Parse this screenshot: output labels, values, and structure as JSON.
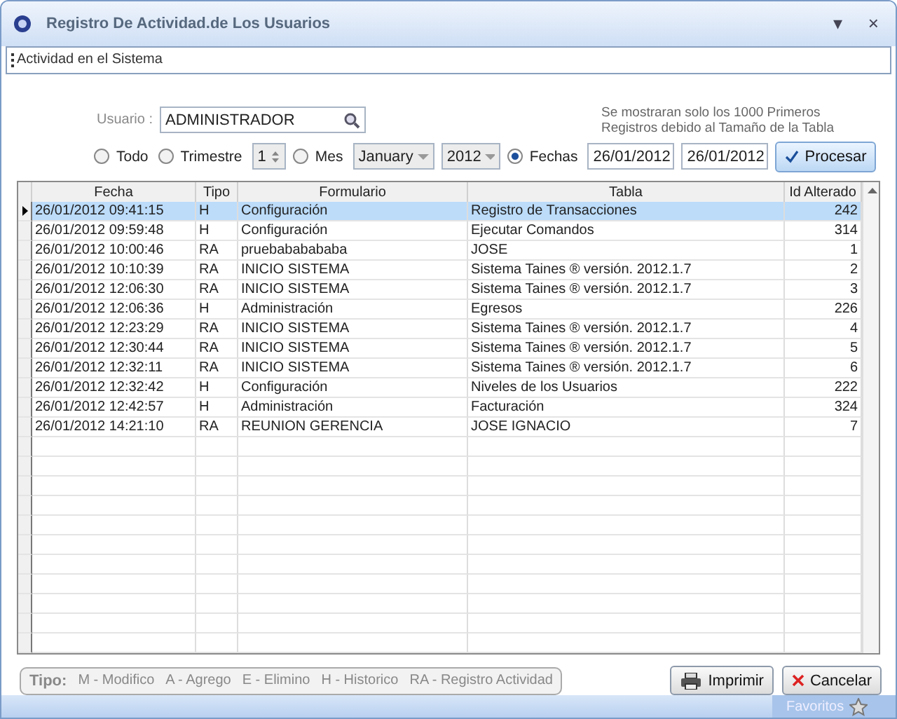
{
  "window": {
    "title": "Registro De Actividad.de Los Usuarios",
    "menu_glyph": "▾",
    "close_glyph": "×"
  },
  "toolbar": {
    "label": "Actividad en el Sistema"
  },
  "filters": {
    "user_label": "Usuario :",
    "user_value": "ADMINISTRADOR",
    "notice": "Se mostraran solo los 1000 Primeros Registros debido al Tamaño de la Tabla",
    "options": [
      {
        "kind": "plain",
        "label": "Todo",
        "selected": false
      },
      {
        "kind": "spin",
        "label": "Trimestre",
        "selected": false,
        "value": "1"
      },
      {
        "kind": "month",
        "label": "Mes",
        "selected": false,
        "month": "January",
        "year": "2012"
      },
      {
        "kind": "dates",
        "label": "Fechas",
        "selected": true,
        "from": "26/01/2012",
        "to": "26/01/2012"
      }
    ],
    "process_button": "Procesar"
  },
  "table": {
    "columns": [
      "Fecha",
      "Tipo",
      "Formulario",
      "Tabla",
      "Id Alterado"
    ],
    "rows": [
      {
        "cells": [
          "26/01/2012 09:41:15",
          "H",
          "Configuración",
          "Registro de Transacciones",
          "242"
        ],
        "selected": true
      },
      {
        "cells": [
          "26/01/2012 09:59:48",
          "H",
          "Configuración",
          "Ejecutar Comandos",
          "314"
        ],
        "selected": false
      },
      {
        "cells": [
          "26/01/2012 10:00:46",
          "RA",
          "pruebababababa",
          "JOSE",
          "1"
        ],
        "selected": false
      },
      {
        "cells": [
          "26/01/2012 10:10:39",
          "RA",
          "INICIO SISTEMA",
          "Sistema Taines ® versión. 2012.1.7",
          "2"
        ],
        "selected": false
      },
      {
        "cells": [
          "26/01/2012 12:06:30",
          "RA",
          "INICIO SISTEMA",
          "Sistema Taines ® versión. 2012.1.7",
          "3"
        ],
        "selected": false
      },
      {
        "cells": [
          "26/01/2012 12:06:36",
          "H",
          "Administración",
          "Egresos",
          "226"
        ],
        "selected": false
      },
      {
        "cells": [
          "26/01/2012 12:23:29",
          "RA",
          "INICIO SISTEMA",
          "Sistema Taines ® versión. 2012.1.7",
          "4"
        ],
        "selected": false
      },
      {
        "cells": [
          "26/01/2012 12:30:44",
          "RA",
          "INICIO SISTEMA",
          "Sistema Taines ® versión. 2012.1.7",
          "5"
        ],
        "selected": false
      },
      {
        "cells": [
          "26/01/2012 12:32:11",
          "RA",
          "INICIO SISTEMA",
          "Sistema Taines ® versión. 2012.1.7",
          "6"
        ],
        "selected": false
      },
      {
        "cells": [
          "26/01/2012 12:32:42",
          "H",
          "Configuración",
          "Niveles de los Usuarios",
          "222"
        ],
        "selected": false
      },
      {
        "cells": [
          "26/01/2012 12:42:57",
          "H",
          "Administración",
          "Facturación",
          "324"
        ],
        "selected": false
      },
      {
        "cells": [
          "26/01/2012 14:21:10",
          "RA",
          "REUNION GERENCIA",
          "JOSE IGNACIO",
          "7"
        ],
        "selected": false
      }
    ]
  },
  "legend": {
    "title": "Tipo:",
    "items": [
      "M - Modifico",
      "A - Agrego",
      "E - Elimino",
      "H - Historico",
      "RA - Registro Actividad"
    ]
  },
  "buttons": [
    {
      "kind": "print",
      "label": "Imprimir"
    },
    {
      "kind": "cancel",
      "label": "Cancelar"
    }
  ],
  "status_bar": {
    "label": "Favoritos"
  }
}
